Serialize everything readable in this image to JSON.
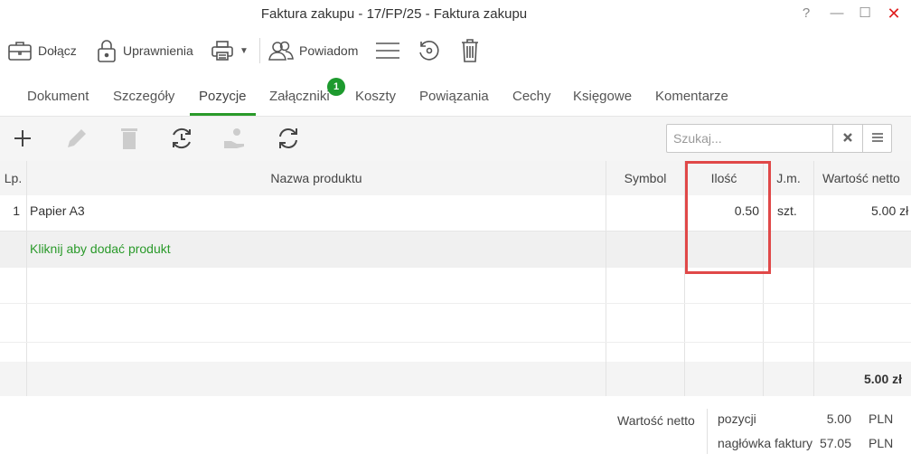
{
  "window": {
    "title": "Faktura zakupu - 17/FP/25 - Faktura zakupu",
    "help": "?",
    "minimize": "—",
    "maximize": "☐",
    "close": "✕"
  },
  "toolbar": {
    "attach_label": "Dołącz",
    "permissions_label": "Uprawnienia",
    "notify_label": "Powiadom"
  },
  "tabs": [
    {
      "label": "Dokument"
    },
    {
      "label": "Szczegóły"
    },
    {
      "label": "Pozycje",
      "active": true
    },
    {
      "label": "Załączniki",
      "badge": "1"
    },
    {
      "label": "Koszty"
    },
    {
      "label": "Powiązania"
    },
    {
      "label": "Cechy"
    },
    {
      "label": "Księgowe"
    },
    {
      "label": "Komentarze"
    }
  ],
  "search": {
    "placeholder": "Szukaj...",
    "value": ""
  },
  "grid": {
    "columns": [
      "Lp.",
      "Nazwa produktu",
      "Symbol",
      "Ilość",
      "J.m.",
      "Wartość netto"
    ],
    "rows": [
      {
        "lp": "1",
        "name": "Papier A3",
        "symbol": "",
        "qty": "0.50",
        "unit": "szt.",
        "net": "5.00 zł"
      }
    ],
    "add_link": "Kliknij aby dodać produkt",
    "sum_net": "5.00 zł"
  },
  "summary": {
    "label": "Wartość netto",
    "rows": [
      {
        "key": "pozycji",
        "value": "5.00",
        "currency": "PLN"
      },
      {
        "key": "nagłówka faktury",
        "value": "57.05",
        "currency": "PLN"
      }
    ]
  },
  "colors": {
    "accent": "#2a9a2a",
    "badge": "#1d9a2e",
    "highlight": "#e04848",
    "close": "#e02020"
  }
}
